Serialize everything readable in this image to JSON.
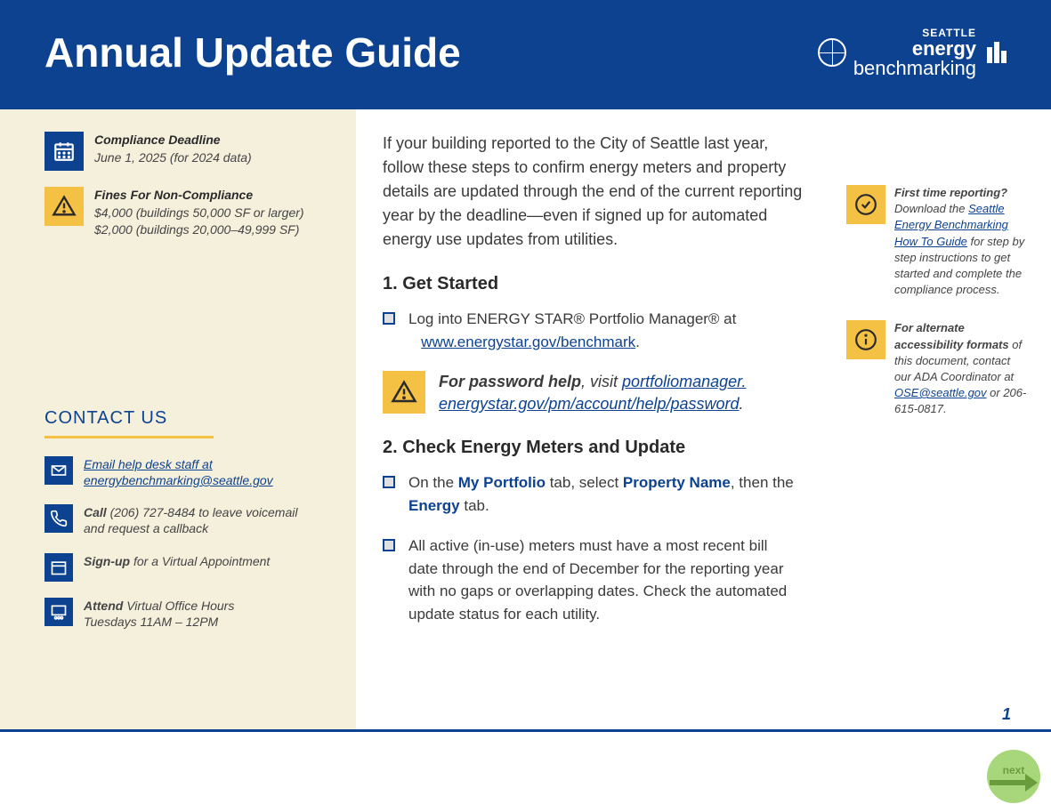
{
  "header": {
    "title": "Annual Update Guide",
    "logo": {
      "small": "SEATTLE",
      "line1": "energy",
      "line2": "benchmarking"
    }
  },
  "left": {
    "deadline": {
      "title": "Compliance Deadline",
      "sub": "June 1, 2025 (for 2024 data)"
    },
    "fines": {
      "title": "Fines For Non-Compliance",
      "line1": "$4,000 (buildings 50,000 SF or larger)",
      "line2": "$2,000 (buildings 20,000–49,999 SF)"
    },
    "contact_heading": "CONTACT US",
    "email": {
      "pre": "Email help desk staff at ",
      "link": "energybenchmarking@seattle.gov"
    },
    "call": {
      "bold": "Call",
      "rest": " (206) 727-8484 to leave voicemail and request a callback"
    },
    "signup": {
      "bold": "Sign-up",
      "rest": " for a Virtual Appointment"
    },
    "attend": {
      "bold": "Attend",
      "rest1": " Virtual Office Hours",
      "rest2": "Tuesdays 11AM – 12PM"
    }
  },
  "main": {
    "intro": "If your building reported to the City of Seattle last year, follow these steps to confirm energy meters and property details are updated through the end of the current reporting year by the deadline—even if signed up for automated energy use updates from utilities.",
    "s1": {
      "heading": "1. Get Started",
      "item1a": "Log into ENERGY STAR® Portfolio Manager® at ",
      "item1link": "www.energystar.gov/benchmark",
      "item1b": ".",
      "callout_bold": "For password help",
      "callout_mid": ", visit ",
      "callout_link": "portfoliomanager. energystar.gov/pm/account/help/password",
      "callout_end": "."
    },
    "s2": {
      "heading": "2. Check Energy Meters and Update",
      "item1a": "On the ",
      "item1b": "My Portfolio",
      "item1c": " tab, select ",
      "item1d": "Property Name",
      "item1e": ", then the ",
      "item1f": "Energy",
      "item1g": " tab.",
      "item2": "All active (in-use) meters must have a most recent bill date through the end of December for the reporting year with no gaps or overlapping dates. Check the automated update status for each utility."
    }
  },
  "right": {
    "first": {
      "bold": "First time reporting?",
      "a": " Download the ",
      "link": "Seattle Energy Benchmarking How To Guide",
      "b": " for step by step instructions to get started and complete the compliance process."
    },
    "alt": {
      "bold": "For alternate accessibility formats",
      "a": " of this document, contact our ADA Coordinator at ",
      "link": "OSE@seattle.gov",
      "b": " or 206-615-0817."
    }
  },
  "footer": {
    "page": "1",
    "next": "next"
  }
}
